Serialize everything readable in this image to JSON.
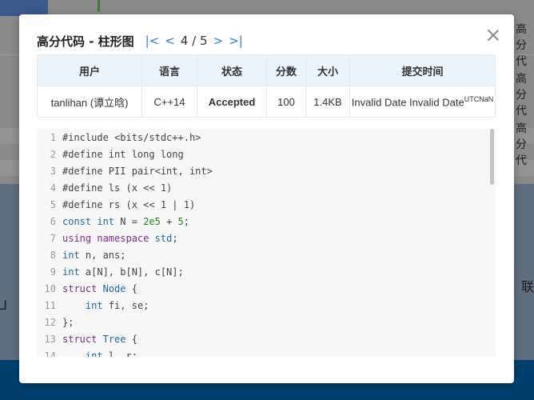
{
  "background": {
    "right_texts": [
      "高分代",
      "高分代",
      "高分代"
    ],
    "right_lower_text": "联",
    "left_glyph": "⅃"
  },
  "modal": {
    "title": "高分代码 - 柱形图",
    "nav": {
      "first": "|<",
      "prev": "<",
      "pager": "4 / 5",
      "next": ">",
      "last": ">|"
    },
    "table": {
      "headers": [
        "用户",
        "语言",
        "状态",
        "分数",
        "大小",
        "提交时间"
      ],
      "row": {
        "user": "tanlihan (谭立晗)",
        "language": "C++14",
        "status": "Accepted",
        "score": "100",
        "size": "1.4KB",
        "time": "Invalid Date Invalid Date",
        "time_sup": "UTCNaN"
      }
    },
    "code": [
      {
        "n": "1",
        "t": "#include <bits/stdc++.h>"
      },
      {
        "n": "2",
        "t": "#define int long long"
      },
      {
        "n": "3",
        "t": "#define PII pair<int, int>"
      },
      {
        "n": "4",
        "t": "#define ls (x << 1)"
      },
      {
        "n": "5",
        "t": "#define rs (x << 1 | 1)"
      },
      {
        "n": "6",
        "t": "const int N = 2e5 + 5;"
      },
      {
        "n": "7",
        "t": "using namespace std;"
      },
      {
        "n": "8",
        "t": "int n, ans;"
      },
      {
        "n": "9",
        "t": "int a[N], b[N], c[N];"
      },
      {
        "n": "10",
        "t": "struct Node {"
      },
      {
        "n": "11",
        "t": "    int fi, se;"
      },
      {
        "n": "12",
        "t": "};"
      },
      {
        "n": "13",
        "t": "struct Tree {"
      },
      {
        "n": "14",
        "t": "    int l, r;"
      }
    ]
  },
  "colors": {
    "accent": "#2d7cd8",
    "accepted": "#2bb52b",
    "table_header_bg": "#e9f4fc"
  }
}
